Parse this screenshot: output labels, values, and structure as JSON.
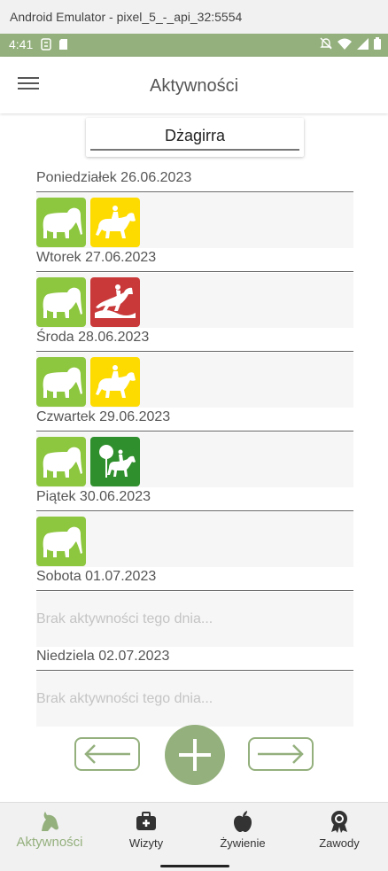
{
  "window": {
    "title": "Android Emulator - pixel_5_-_api_32:5554"
  },
  "statusbar": {
    "time": "4:41"
  },
  "appbar": {
    "title": "Aktywności"
  },
  "horse_select": {
    "value": "Dżagirra"
  },
  "days": [
    {
      "label": "Poniedziałek 26.06.2023",
      "activities": [
        "grazing-horse-icon",
        "riding-horse-icon"
      ]
    },
    {
      "label": "Wtorek 27.06.2023",
      "activities": [
        "grazing-horse-icon",
        "jumping-horse-icon"
      ]
    },
    {
      "label": "Środa 28.06.2023",
      "activities": [
        "grazing-horse-icon",
        "riding-horse-icon"
      ]
    },
    {
      "label": "Czwartek 29.06.2023",
      "activities": [
        "grazing-horse-icon",
        "trail-riding-icon"
      ]
    },
    {
      "label": "Piątek 30.06.2023",
      "activities": [
        "grazing-horse-icon"
      ]
    },
    {
      "label": "Sobota 01.07.2023",
      "activities": [],
      "empty": "Brak aktywności tego dnia..."
    },
    {
      "label": "Niedziela 02.07.2023",
      "activities": [],
      "empty": "Brak aktywności tego dnia..."
    }
  ],
  "colors": {
    "accent": "#94b07d",
    "grazing": "#8dc63f",
    "riding": "#fddb00",
    "jumping": "#c9393a",
    "trail": "#2f8f2c"
  },
  "nav": {
    "items": [
      {
        "label": "Aktywności",
        "icon": "horse-head-icon",
        "active": true
      },
      {
        "label": "Wizyty",
        "icon": "medical-kit-icon",
        "active": false
      },
      {
        "label": "Żywienie",
        "icon": "apple-icon",
        "active": false
      },
      {
        "label": "Zawody",
        "icon": "award-ribbon-icon",
        "active": false
      }
    ]
  }
}
